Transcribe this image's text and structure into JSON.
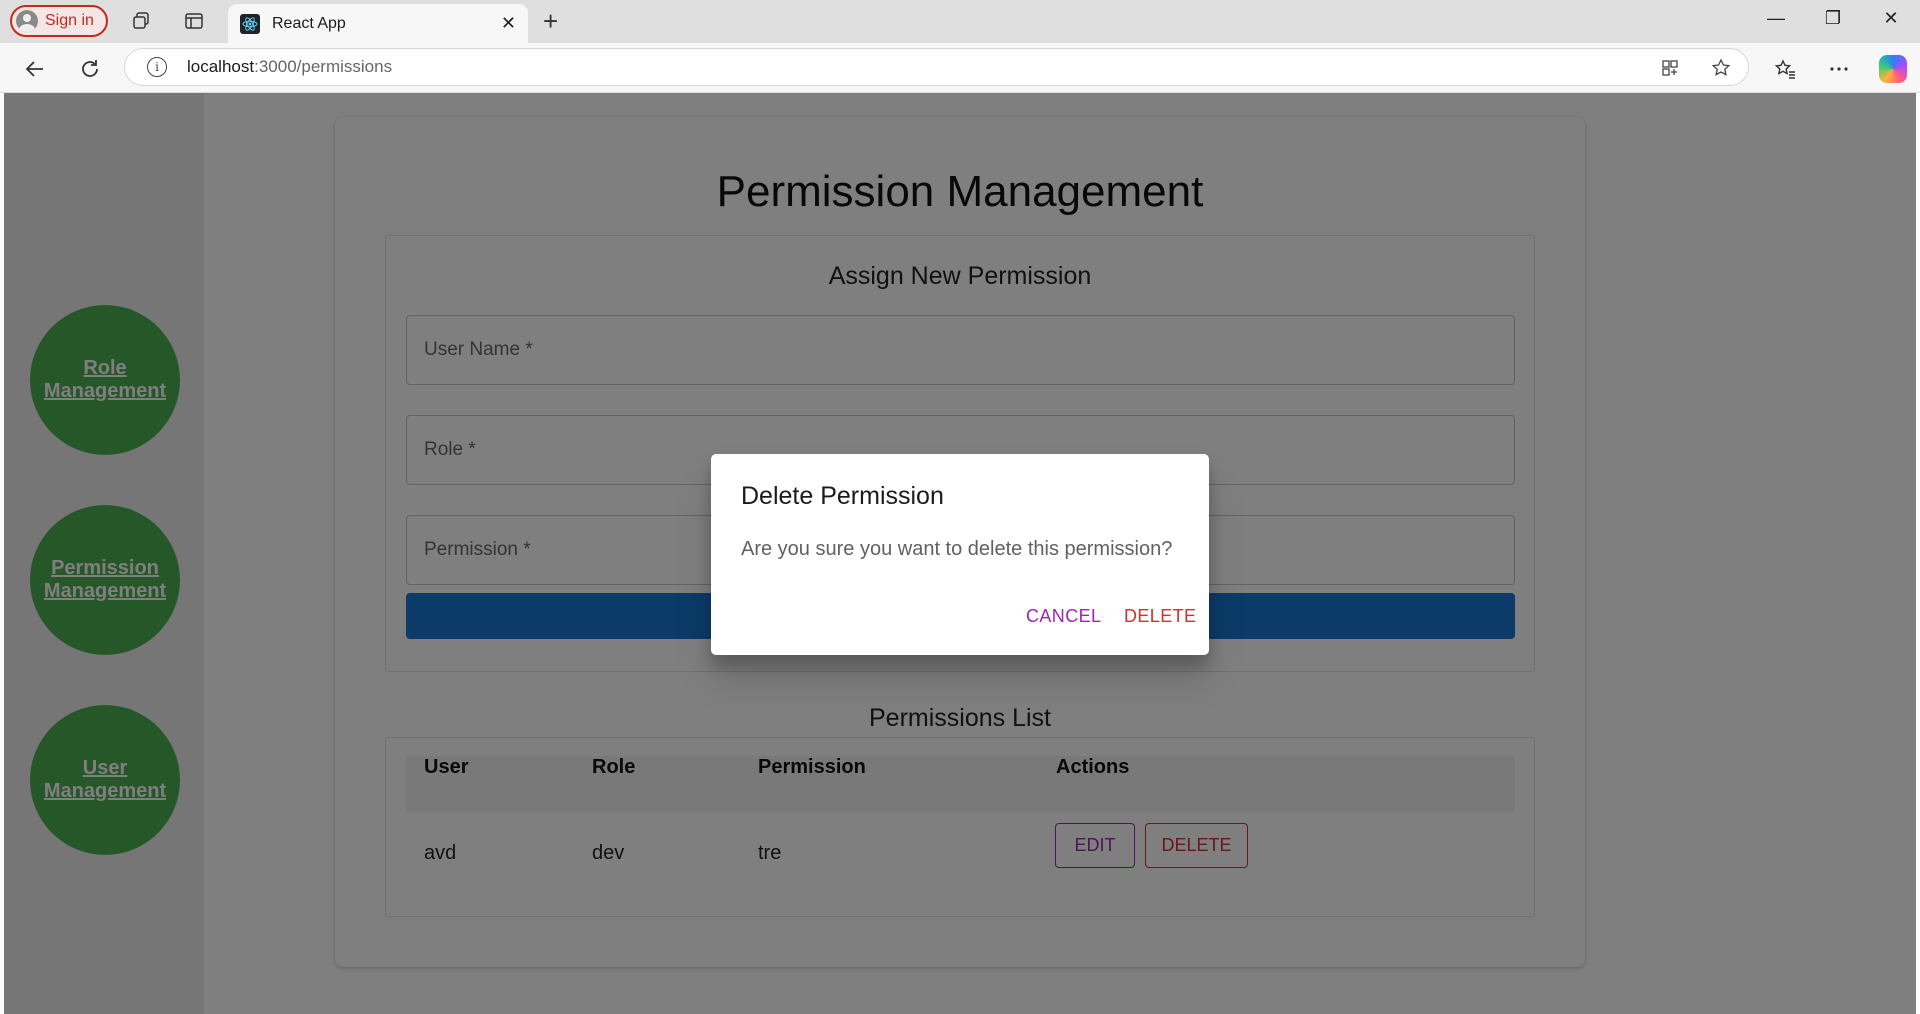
{
  "browser": {
    "signin_label": "Sign in",
    "tab_title": "React App",
    "url_host": "localhost",
    "url_path": ":3000/permissions"
  },
  "sidebar": {
    "items": [
      {
        "line1": "Role",
        "line2": "Management"
      },
      {
        "line1": "Permission",
        "line2": "Management"
      },
      {
        "line1": "User",
        "line2": "Management"
      }
    ]
  },
  "page": {
    "title": "Permission Management",
    "form": {
      "title": "Assign New Permission",
      "user_placeholder": "User Name *",
      "role_placeholder": "Role *",
      "permission_placeholder": "Permission *"
    },
    "list": {
      "title": "Permissions List",
      "columns": [
        "User",
        "Role",
        "Permission",
        "Actions"
      ],
      "rows": [
        {
          "user": "avd",
          "role": "dev",
          "permission": "tre",
          "edit_label": "EDIT",
          "delete_label": "DELETE"
        }
      ]
    }
  },
  "dialog": {
    "title": "Delete Permission",
    "message": "Are you sure you want to delete this permission?",
    "cancel_label": "CANCEL",
    "delete_label": "DELETE"
  },
  "colors": {
    "sidebar_button": "#4caf50",
    "primary": "#1976d2",
    "secondary": "#9c27b0",
    "error": "#d32f2f"
  }
}
